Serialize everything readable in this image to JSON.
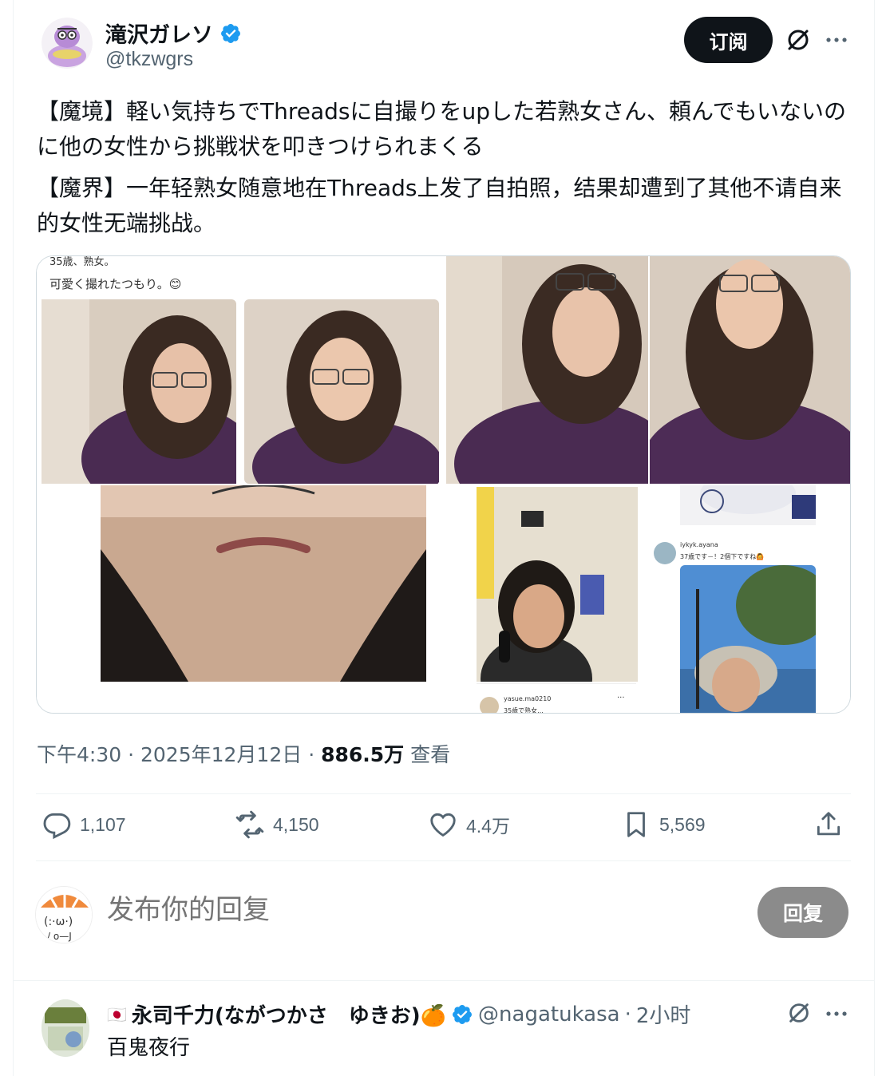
{
  "tweet": {
    "author_name": "滝沢ガレソ",
    "author_handle": "@tkzwgrs",
    "subscribe_label": "订阅",
    "text_line1": "【魔境】軽い気持ちでThreadsに自撮りをupした若熟女さん、頼んでもいないのに他の女性から挑戦状を叩きつけられまくる",
    "text_line2": "【魔界】一年轻熟女随意地在Threads上发了自拍照，结果却遭到了其他不请自来的女性无端挑战。",
    "time": "下午4:30",
    "date": "2025年12月12日",
    "views_count": "886.5万",
    "views_label": "查看",
    "replies": "1,107",
    "retweets": "4,150",
    "likes": "4.4万",
    "bookmarks": "5,569"
  },
  "media": {
    "post1_caption_top": "35歳、熟女。",
    "post1_caption": "可愛く撮れたつもり。😊",
    "reply1_user": "yasue.ma0210",
    "reply1_text": "35歳で熟女...",
    "reply2_user": "iykyk.ayana",
    "reply2_text": "37歳です－！2個下ですね🙆",
    "dots": "···"
  },
  "composer": {
    "placeholder": "发布你的回复",
    "reply_button": "回复"
  },
  "reply": {
    "flag": "🇯🇵",
    "name": "永司千力(ながつかさ　ゆきお)🍊",
    "handle": "@nagatukasa",
    "time": "2小时",
    "text": "百鬼夜行"
  },
  "colors": {
    "text_primary": "#0f1419",
    "text_secondary": "#536471",
    "verified_blue": "#1d9bf0",
    "subscribe_bg": "#0f1419",
    "reply_button_bg": "#8b8b8b",
    "border": "#eff3f4"
  }
}
